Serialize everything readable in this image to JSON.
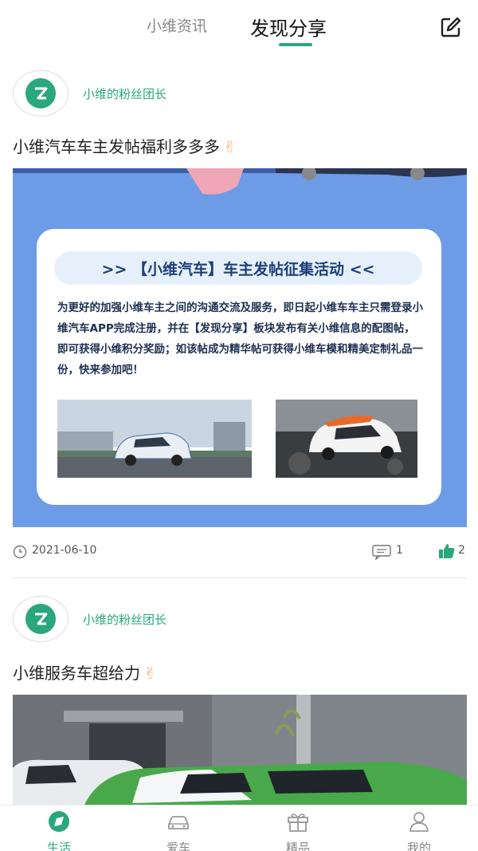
{
  "top_tabs": {
    "inactive_tab": "小维资讯",
    "active_tab": "发现分享"
  },
  "posts": [
    {
      "username": "小维的粉丝团长",
      "title": "小维汽车车主发帖福利多多多",
      "emoji": "✌",
      "banner": {
        "heading": ">> 【小维汽车】车主发帖征集活动 <<",
        "body": "为更好的加强小维车主之间的沟通交流及服务，即日起小维车车主只需登录小维汽车APP完成注册，并在【发现分享】板块发布有关小维信息的配图帖，即可获得小维积分奖励；如该帖成为精华帖可获得小维车模和精美定制礼品一份，快来参加吧！"
      },
      "date": "2021-06-10",
      "comments": "1",
      "likes": "2"
    },
    {
      "username": "小维的粉丝团长",
      "title": "小维服务车超给力",
      "emoji": "✌"
    }
  ],
  "bottom_nav": [
    {
      "label": "生活",
      "icon": "life-icon",
      "active": true
    },
    {
      "label": "爱车",
      "icon": "car-icon",
      "active": false
    },
    {
      "label": "精品",
      "icon": "gift-icon",
      "active": false
    },
    {
      "label": "我的",
      "icon": "profile-icon",
      "active": false
    }
  ],
  "colors": {
    "accent": "#2aa77c",
    "banner_blue": "#6e9be6"
  }
}
